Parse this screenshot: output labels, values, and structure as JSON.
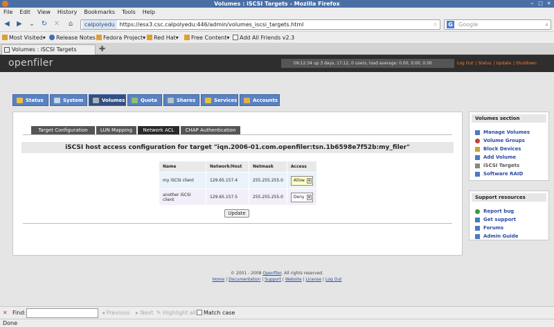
{
  "window": {
    "title": "Volumes : iSCSI Targets - Mozilla Firefox"
  },
  "menu": [
    "File",
    "Edit",
    "View",
    "History",
    "Bookmarks",
    "Tools",
    "Help"
  ],
  "nav": {
    "site": "calpolyedu",
    "url": "https://esx3.csc.calpolyedu:446/admin/volumes_iscsi_targets.html",
    "search_placeholder": "Google"
  },
  "bookmarks": [
    "Most Visited",
    "Release Notes",
    "Fedora Project",
    "Red Hat",
    "Free Content",
    "Add All Friends v2.3"
  ],
  "tab": {
    "title": "Volumes : iSCSI Targets"
  },
  "header": {
    "logo": "openfiler",
    "status": "09:12:34 up 3 days, 17:12, 0 users, load average: 0.00, 0.00, 0.00",
    "links": [
      "Log Out",
      "Status",
      "Update",
      "Shutdown"
    ]
  },
  "main_tabs": [
    "Status",
    "System",
    "Volumes",
    "Quota",
    "Shares",
    "Services",
    "Accounts"
  ],
  "sub_tabs": [
    "Target Configuration",
    "LUN Mapping",
    "Network ACL",
    "CHAP Authentication"
  ],
  "heading": "iSCSI host access configuration for target \"iqn.2006-01.com.openfiler:tsn.1b6598e7f52b:my_filer\"",
  "table": {
    "headers": [
      "Name",
      "Network/Host",
      "Netmask",
      "Access"
    ],
    "rows": [
      {
        "name": "my iSCSI client",
        "host": "129.65.157.4",
        "netmask": "255.255.255.0",
        "access": "Allow"
      },
      {
        "name": "another iSCSI client",
        "host": "129.65.157.5",
        "netmask": "255.255.255.0",
        "access": "Deny"
      }
    ]
  },
  "update_button": "Update",
  "footer": {
    "copyright": "© 2001 - 2008 ",
    "openfiler_link": "Openfiler",
    "rights": ". All rights reserved.",
    "links": [
      "Home",
      "Documentation",
      "Support",
      "Website",
      "License",
      "Log Out"
    ]
  },
  "volumes_section": {
    "title": "Volumes section",
    "items": [
      "Manage Volumes",
      "Volume Groups",
      "Block Devices",
      "Add Volume",
      "iSCSI Targets",
      "Software RAID"
    ]
  },
  "support_section": {
    "title": "Support resources",
    "items": [
      "Report bug",
      "Get support",
      "Forums",
      "Admin Guide"
    ]
  },
  "findbar": {
    "label": "Find:",
    "previous": "Previous",
    "next": "Next",
    "highlight": "Highlight all",
    "match_case": "Match case"
  },
  "status": "Done",
  "colors": {
    "tab_blue": "#5b82c0",
    "tab_active": "#334f82",
    "header_dark": "#2e2e2e",
    "header_links": "#ff7a2a",
    "link_blue": "#2a4aa0"
  }
}
